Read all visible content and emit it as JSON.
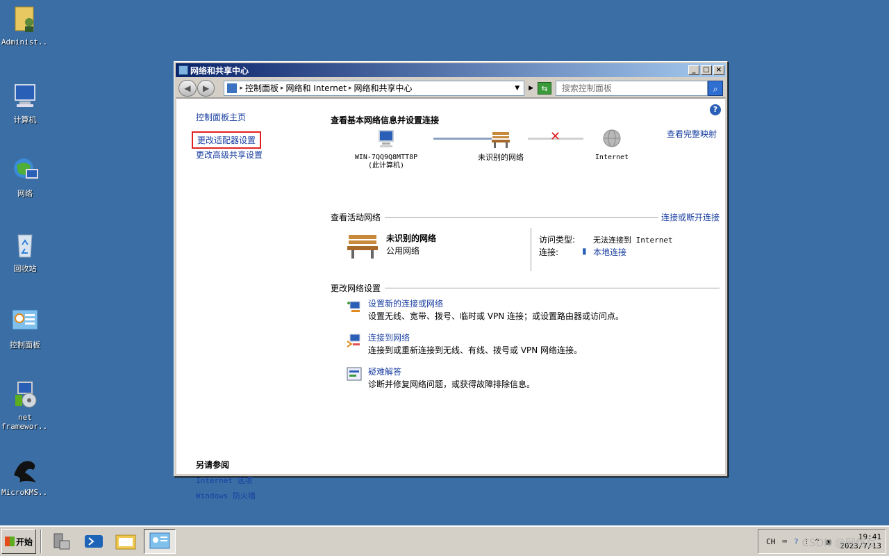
{
  "desktop": {
    "icons": [
      {
        "label": "Administ..."
      },
      {
        "label": "计算机"
      },
      {
        "label": "网络"
      },
      {
        "label": "回收站"
      },
      {
        "label": "控制面板"
      },
      {
        "label1": "net",
        "label2": "framewor..."
      },
      {
        "label": "MicroKMS..."
      }
    ]
  },
  "window": {
    "title": "网络和共享中心",
    "breadcrumb": [
      "控制面板",
      "网络和 Internet",
      "网络和共享中心"
    ],
    "search_placeholder": "搜索控制面板"
  },
  "sidebar": {
    "home": "控制面板主页",
    "adapter": "更改适配器设置",
    "advanced": "更改高级共享设置"
  },
  "see_also": {
    "heading": "另请参阅",
    "items": [
      "Internet 选项",
      "Windows 防火墙"
    ]
  },
  "main": {
    "title": "查看基本网络信息并设置连接",
    "full_map": "查看完整映射",
    "map": {
      "computer_line1": "WIN-7QQ9Q8MTT8P",
      "computer_line2": "(此计算机)",
      "network": "未识别的网络",
      "internet": "Internet"
    },
    "active_section": "查看活动网络",
    "connect_disconnect": "连接或断开连接",
    "active": {
      "name": "未识别的网络",
      "type": "公用网络",
      "access_label": "访问类型:",
      "access_value": "无法连接到 Internet",
      "conn_label": "连接:",
      "conn_value": "本地连接"
    },
    "change_section": "更改网络设置",
    "tasks": [
      {
        "title": "设置新的连接或网络",
        "desc": "设置无线、宽带、拨号、临时或 VPN 连接；或设置路由器或访问点。"
      },
      {
        "title": "连接到网络",
        "desc": "连接到或重新连接到无线、有线、拨号或 VPN 网络连接。"
      },
      {
        "title": "疑难解答",
        "desc": "诊断并修复网络问题，或获得故障排除信息。"
      }
    ]
  },
  "taskbar": {
    "start": "开始",
    "lang": "CH",
    "time": "19:41",
    "date": "2023/7/13"
  },
  "watermark": "CSDN @网络豆"
}
